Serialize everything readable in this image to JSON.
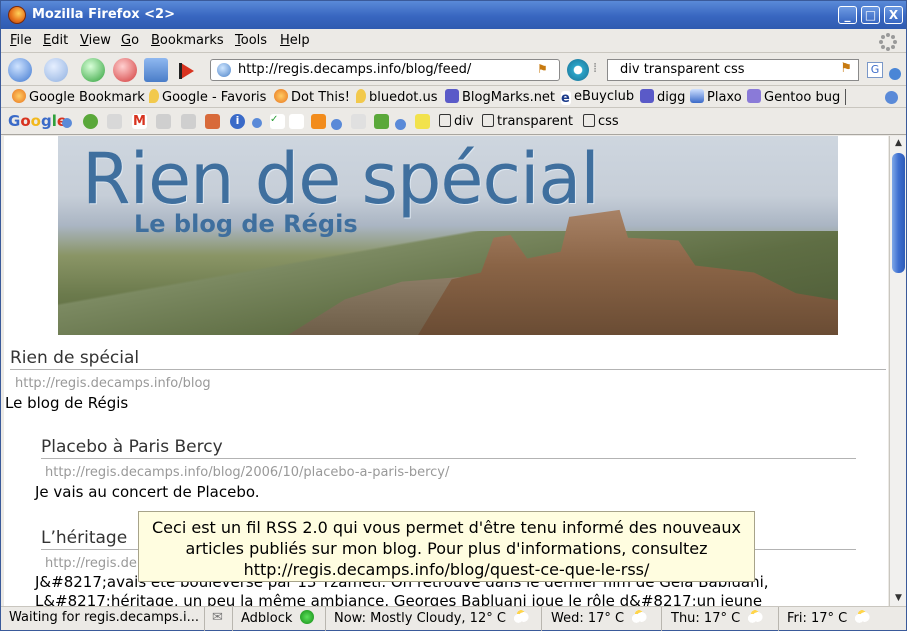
{
  "window": {
    "title": "Mozilla Firefox <2>",
    "controls": [
      "_",
      "□",
      "X"
    ]
  },
  "menu": [
    {
      "label": "File",
      "key": "F",
      "rest": "ile"
    },
    {
      "label": "Edit",
      "key": "E",
      "rest": "dit"
    },
    {
      "label": "View",
      "key": "V",
      "rest": "iew"
    },
    {
      "label": "Go",
      "key": "G",
      "rest": "o"
    },
    {
      "label": "Bookmarks",
      "key": "B",
      "rest": "ookmarks"
    },
    {
      "label": "Tools",
      "key": "T",
      "rest": "ools"
    },
    {
      "label": "Help",
      "key": "H",
      "rest": "elp"
    }
  ],
  "nav": {
    "url": "http://regis.decamps.info/blog/feed/",
    "search": "div transparent css"
  },
  "bookmarks": [
    "Google Bookmark",
    "Google - Favoris",
    "Dot This!",
    "bluedot.us",
    "BlogMarks.net",
    "eBuyclub",
    "digg",
    "Plaxo",
    "Gentoo bug"
  ],
  "google_toolbar": {
    "logo": "Google",
    "queries": [
      "div",
      "transparent",
      "css"
    ]
  },
  "banner": {
    "title": "Rien de spécial",
    "subtitle": "Le blog de Régis"
  },
  "feed": {
    "title": "Rien de spécial",
    "link": "http://regis.decamps.info/blog",
    "description": "Le blog de Régis",
    "items": [
      {
        "title": "Placebo à Paris Bercy",
        "link": "http://regis.decamps.info/blog/2006/10/placebo-a-paris-bercy/",
        "description": "Je vais au concert de Placebo."
      },
      {
        "title": "L’héritage",
        "link": "http://regis.de",
        "line1": "J&#8217;avais été bouleversé par 13 Tzameti. On retrouve dans le dernier film de Gela Babluani,",
        "line2": "L&#8217;héritage, un peu la même ambiance. Georges Babluani joue le rôle d&#8217;un jeune"
      }
    ]
  },
  "tooltip": {
    "line1": "Ceci est un fil RSS 2.0 qui vous permet d'être tenu informé des nouveaux",
    "line2": "articles publiés sur mon blog. Pour plus d'informations, consultez",
    "line3": "http://regis.decamps.info/blog/quest-ce-que-le-rss/"
  },
  "status": {
    "loading": "Waiting for regis.decamps.i...",
    "adblock": "Adblock",
    "now": "Now: Mostly Cloudy, 12° C",
    "wed": "Wed: 17° C",
    "thu": "Thu: 17° C",
    "fri": "Fri: 17° C"
  }
}
